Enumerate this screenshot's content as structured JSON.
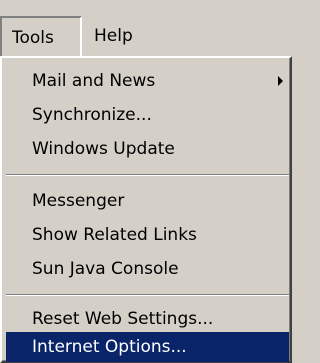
{
  "menubar": {
    "items": [
      {
        "label": "Tools",
        "state": "open"
      },
      {
        "label": "Help"
      }
    ]
  },
  "menu": {
    "groups": [
      [
        {
          "label": "Mail and News",
          "submenu": true
        },
        {
          "label": "Synchronize..."
        },
        {
          "label": "Windows Update"
        }
      ],
      [
        {
          "label": "Messenger"
        },
        {
          "label": "Show Related Links"
        },
        {
          "label": "Sun Java Console"
        }
      ],
      [
        {
          "label": "Reset Web Settings..."
        },
        {
          "label": "Internet Options...",
          "selected": true
        }
      ]
    ]
  },
  "colors": {
    "menu_background": "#d4d0c8",
    "selection_background": "#0a246a",
    "selection_text": "#ffffff"
  }
}
